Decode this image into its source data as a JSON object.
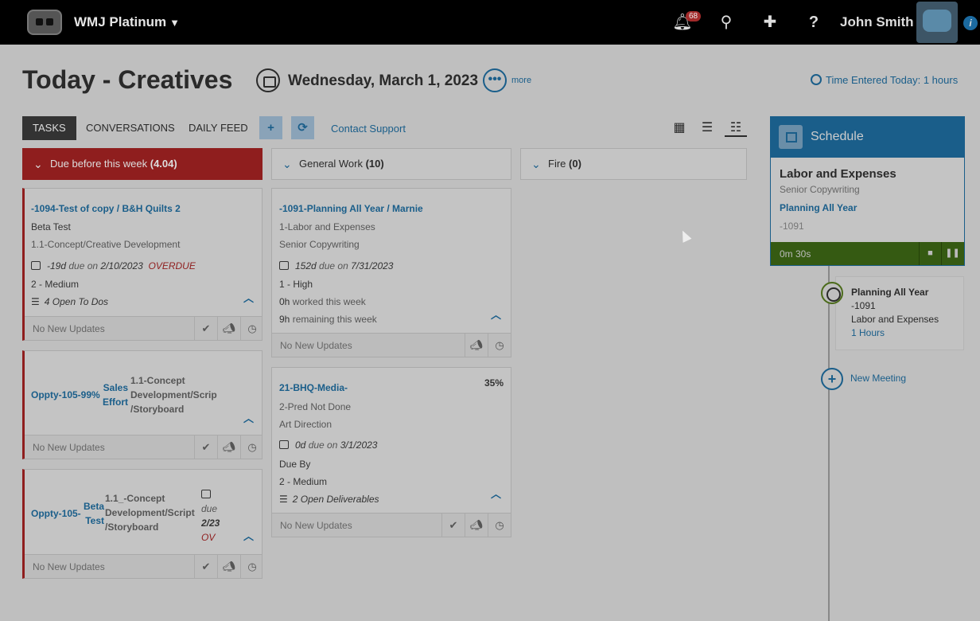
{
  "topbar": {
    "org_name": "WMJ Platinum",
    "notification_count": "68",
    "user_name": "John Smith",
    "info_label": "i"
  },
  "header": {
    "title": "Today - Creatives",
    "date": "Wednesday, March 1, 2023",
    "more_label": "more",
    "time_entered": "Time Entered Today: 1 hours"
  },
  "tabs": [
    {
      "label": "TASKS"
    },
    {
      "label": "CONVERSATIONS"
    },
    {
      "label": "DAILY FEED"
    }
  ],
  "toolbar": {
    "add_glyph": "+",
    "refresh_glyph": "⟳",
    "contact_support": "Contact Support"
  },
  "columns": [
    {
      "label": "Due before this week",
      "count": "(4.04)"
    },
    {
      "label": "General Work",
      "count": "(10)"
    },
    {
      "label": "Fire",
      "count": "(0)"
    }
  ],
  "cards": {
    "c1": {
      "title": "-1094-Test of copy / B&H Quilts 2",
      "line1": "Beta Test",
      "line2": "1.1-Concept/Creative Development",
      "days": "-19d",
      "due_on": "due on",
      "due_date": "2/10/2023",
      "status": "OVERDUE",
      "priority": "2 - Medium",
      "todos": "4 Open To Dos",
      "footer": "No New Updates"
    },
    "c2": {
      "title": "Oppty-105-99%",
      "col2": [
        "Sales",
        "Effort"
      ],
      "col3": [
        "1.1-Concept",
        "Development/Scrip",
        "/Storyboard"
      ],
      "footer": "No New Updates"
    },
    "c3": {
      "title": "Oppty-105-",
      "col2": [
        "Beta",
        "Test"
      ],
      "col3": [
        "1.1_-Concept",
        "Development/Script",
        "/Storyboard"
      ],
      "due_on": "due",
      "due_date": "2/23",
      "status": "OV",
      "footer": "No New Updates"
    },
    "c4": {
      "title": "-1091-Planning All Year / Marnie",
      "line1": "1-Labor and Expenses",
      "line2": "Senior Copywriting",
      "days": "152d",
      "due_on": "due on",
      "due_date": "7/31/2023",
      "priority": "1 - High",
      "worked": "0h",
      "worked_label": "worked this week",
      "remaining": "9h",
      "remaining_label": "remaining this week",
      "footer": "No New Updates"
    },
    "c5": {
      "title": "21-BHQ-Media-",
      "percent": "35%",
      "line1": "2-Pred Not Done",
      "line2": "Art Direction",
      "days": "0d",
      "due_on": "due on",
      "due_date": "3/1/2023",
      "due_by": "Due By",
      "priority": "2 - Medium",
      "deliverables": "2 Open Deliverables",
      "footer": "No New Updates"
    }
  },
  "schedule": {
    "header": "Schedule",
    "job": "Labor and Expenses",
    "sub": "Senior Copywriting",
    "link": "Planning All Year",
    "number": "-1091",
    "timer": "0m 30s"
  },
  "timeline": {
    "title": "Planning All Year",
    "number": "-1091",
    "task": "Labor and Expenses",
    "hours": "1 Hours",
    "new_meeting": "New Meeting"
  }
}
